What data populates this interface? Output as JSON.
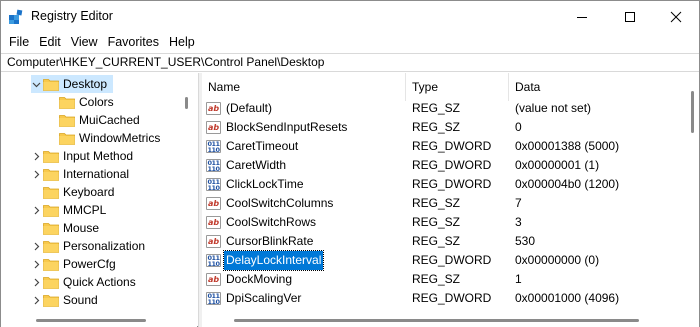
{
  "window": {
    "title": "Registry Editor"
  },
  "menu": [
    "File",
    "Edit",
    "View",
    "Favorites",
    "Help"
  ],
  "address": "Computer\\HKEY_CURRENT_USER\\Control Panel\\Desktop",
  "tree": [
    {
      "label": "Desktop",
      "level": 0,
      "expanded": true,
      "selected": true
    },
    {
      "label": "Colors",
      "level": 1,
      "expanded": null
    },
    {
      "label": "MuiCached",
      "level": 1,
      "expanded": null
    },
    {
      "label": "WindowMetrics",
      "level": 1,
      "expanded": null
    },
    {
      "label": "Input Method",
      "level": 0,
      "expanded": false
    },
    {
      "label": "International",
      "level": 0,
      "expanded": false
    },
    {
      "label": "Keyboard",
      "level": 0,
      "expanded": null
    },
    {
      "label": "MMCPL",
      "level": 0,
      "expanded": false
    },
    {
      "label": "Mouse",
      "level": 0,
      "expanded": null
    },
    {
      "label": "Personalization",
      "level": 0,
      "expanded": false
    },
    {
      "label": "PowerCfg",
      "level": 0,
      "expanded": false
    },
    {
      "label": "Quick Actions",
      "level": 0,
      "expanded": false
    },
    {
      "label": "Sound",
      "level": 0,
      "expanded": false
    }
  ],
  "columns": {
    "name": "Name",
    "type": "Type",
    "data": "Data"
  },
  "values": [
    {
      "name": "(Default)",
      "type": "REG_SZ",
      "data": "(value not set)",
      "icon": "string-value-icon"
    },
    {
      "name": "BlockSendInputResets",
      "type": "REG_SZ",
      "data": "0",
      "icon": "string-value-icon"
    },
    {
      "name": "CaretTimeout",
      "type": "REG_DWORD",
      "data": "0x00001388 (5000)",
      "icon": "binary-value-icon"
    },
    {
      "name": "CaretWidth",
      "type": "REG_DWORD",
      "data": "0x00000001 (1)",
      "icon": "binary-value-icon"
    },
    {
      "name": "ClickLockTime",
      "type": "REG_DWORD",
      "data": "0x000004b0 (1200)",
      "icon": "binary-value-icon"
    },
    {
      "name": "CoolSwitchColumns",
      "type": "REG_SZ",
      "data": "7",
      "icon": "string-value-icon"
    },
    {
      "name": "CoolSwitchRows",
      "type": "REG_SZ",
      "data": "3",
      "icon": "string-value-icon"
    },
    {
      "name": "CursorBlinkRate",
      "type": "REG_SZ",
      "data": "530",
      "icon": "string-value-icon"
    },
    {
      "name": "DelayLockInterval",
      "type": "REG_DWORD",
      "data": "0x00000000 (0)",
      "icon": "binary-value-icon",
      "selected": true
    },
    {
      "name": "DockMoving",
      "type": "REG_SZ",
      "data": "1",
      "icon": "string-value-icon"
    },
    {
      "name": "DpiScalingVer",
      "type": "REG_DWORD",
      "data": "0x00001000 (4096)",
      "icon": "binary-value-icon"
    }
  ],
  "colors": {
    "selection": "#0078d7",
    "tree_selection": "#cce8ff",
    "folder": "#f8c94c"
  }
}
